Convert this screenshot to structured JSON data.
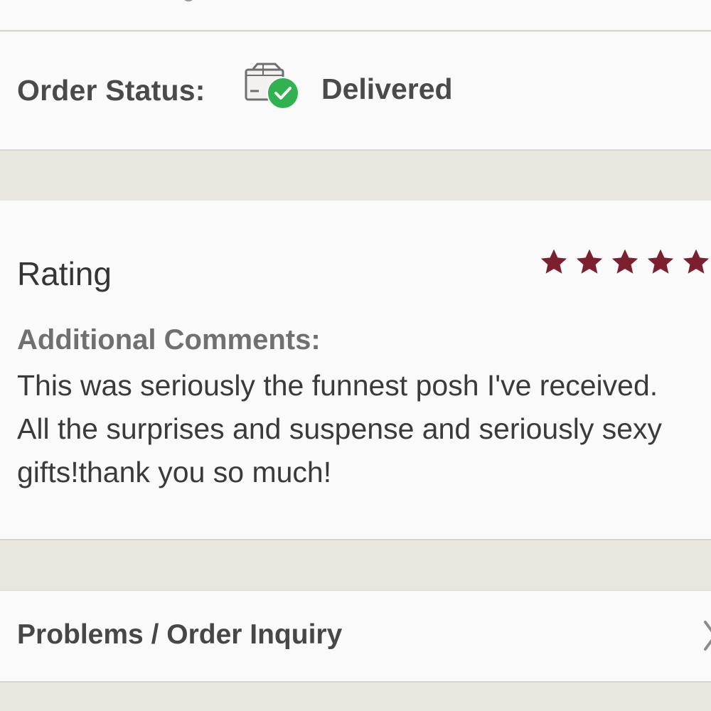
{
  "order_status": {
    "label": "Order Status:",
    "value": "Delivered",
    "icon": "package-delivered-icon",
    "accent_color": "#2fb24f"
  },
  "rating": {
    "title": "Rating",
    "stars": 5,
    "star_color": "#7c1f2e",
    "comments_label": "Additional Comments:",
    "comments_text": "This was seriously the funnest posh I've received. All the surprises and suspense and seriously sexy gifts!thank you so much!"
  },
  "problems": {
    "label": "Problems / Order Inquiry",
    "icon": "chevron-right-icon"
  }
}
